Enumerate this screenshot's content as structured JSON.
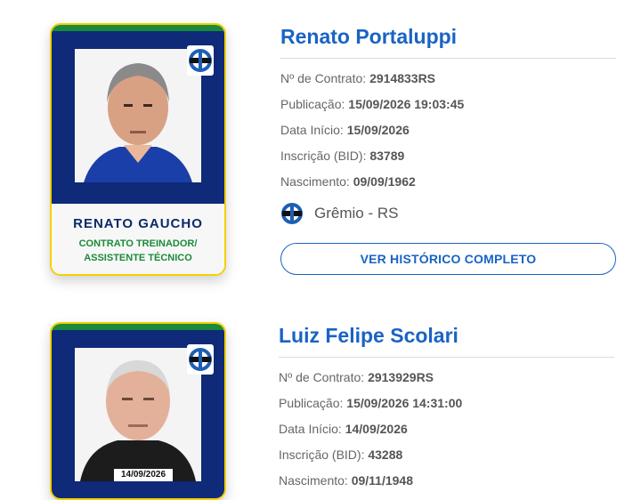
{
  "coaches": [
    {
      "name": "Renato Portaluppi",
      "card": {
        "nickname": "RENATO GAUCHO",
        "role_line1": "CONTRATO TREINADOR/",
        "role_line2": "ASSISTENTE TÉCNICO",
        "photo_date": ""
      },
      "fields": [
        {
          "label": "Nº de Contrato:",
          "value": "2914833RS"
        },
        {
          "label": "Publicação:",
          "value": "15/09/2026 19:03:45"
        },
        {
          "label": "Data Início:",
          "value": "15/09/2026"
        },
        {
          "label": "Inscrição (BID):",
          "value": "83789"
        },
        {
          "label": "Nascimento:",
          "value": "09/09/1962"
        }
      ],
      "club": "Grêmio - RS",
      "button_label": "VER HISTÓRICO COMPLETO"
    },
    {
      "name": "Luiz Felipe Scolari",
      "card": {
        "photo_date": "14/09/2026"
      },
      "fields": [
        {
          "label": "Nº de Contrato:",
          "value": "2913929RS"
        },
        {
          "label": "Publicação:",
          "value": "15/09/2026 14:31:00"
        },
        {
          "label": "Data Início:",
          "value": "14/09/2026"
        },
        {
          "label": "Inscrição (BID):",
          "value": "43288"
        },
        {
          "label": "Nascimento:",
          "value": "09/11/1948"
        }
      ]
    }
  ],
  "colors": {
    "accent": "#1a63c4",
    "card_navy": "#0e2a78",
    "card_green": "#1b8a3a",
    "card_border": "#f5d000"
  },
  "icons": {
    "crest": "gremio-crest-icon"
  }
}
